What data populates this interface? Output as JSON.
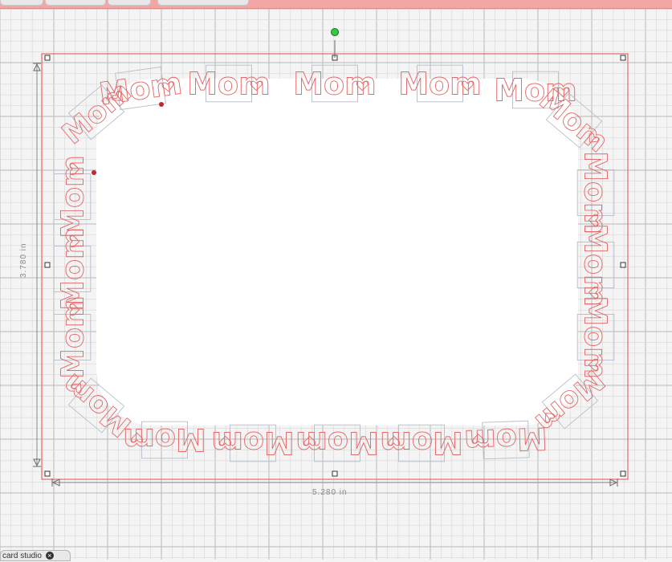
{
  "header": {
    "tabs": [
      "",
      "",
      "",
      ""
    ]
  },
  "design": {
    "word": "Mom",
    "width_label": "5.280 in",
    "height_label": "3.780 in"
  },
  "bottom_tab": {
    "label": "card studio"
  },
  "colors": {
    "cut_line": "#e46a6a",
    "selection_box": "#b8c0cc",
    "grid_minor": "#d7d7d7",
    "grid_major": "#b9b9b9",
    "handle_rotate": "#2ecc40"
  }
}
